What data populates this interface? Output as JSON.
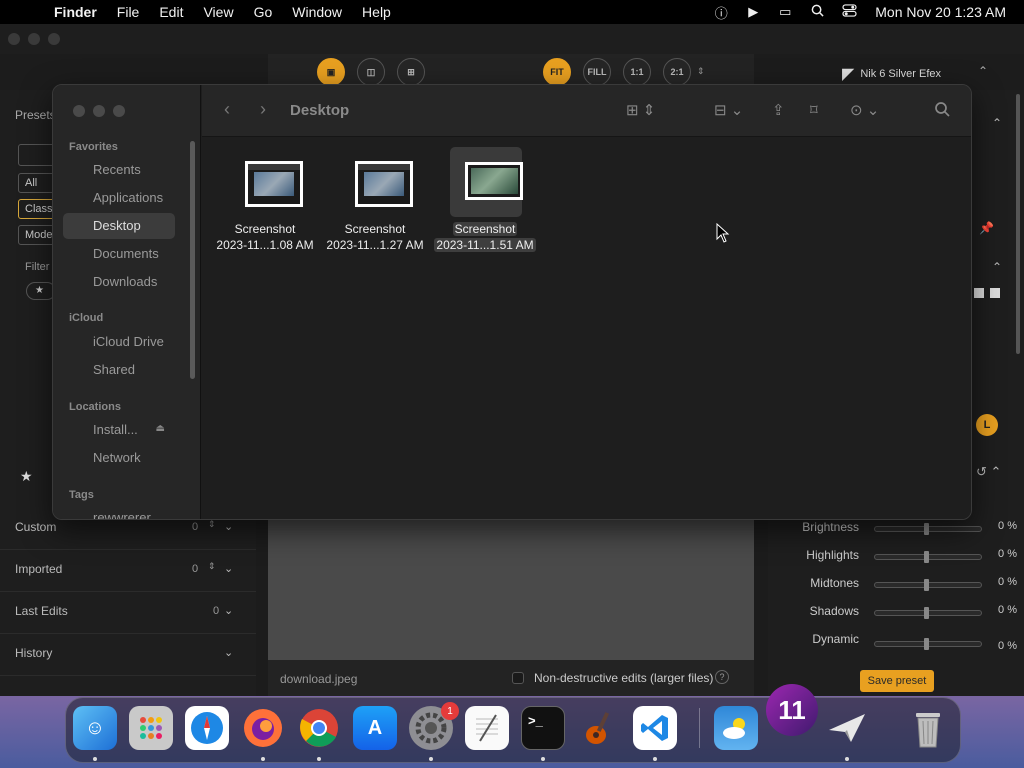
{
  "menubar": {
    "apple": "",
    "app_name": "Finder",
    "menus": [
      "File",
      "Edit",
      "View",
      "Go",
      "Window",
      "Help"
    ],
    "status_icons": [
      "accessibility-icon",
      "play-icon",
      "screen-mirror-icon",
      "search-icon",
      "control-center-icon"
    ],
    "clock": "Mon Nov 20  1:23 AM"
  },
  "nik": {
    "title": "Nik 6 Silver Efex",
    "toolbar": {
      "fit": "FIT",
      "fill": "FILL",
      "one_to_one": "1:1",
      "two_to_one": "2:1"
    },
    "left": {
      "presets_label": "Presets",
      "filter_all": "All",
      "filter_classic": "Class",
      "filter_modern": "Mode",
      "filter_label": "Filter",
      "star": "★",
      "rows": [
        {
          "label": "Custom",
          "count": "0"
        },
        {
          "label": "Imported",
          "count": "0"
        },
        {
          "label": "Last Edits",
          "count": "0"
        },
        {
          "label": "History",
          "count": ""
        }
      ]
    },
    "bottom": {
      "filename": "download.jpeg",
      "non_destructive": "Non-destructive edits (larger files)",
      "help": "?"
    },
    "right": {
      "l_badge": "L",
      "sliders": [
        {
          "label": "Brightness",
          "value": "0 %"
        },
        {
          "label": "Highlights",
          "value": "0 %"
        },
        {
          "label": "Midtones",
          "value": "0 %"
        },
        {
          "label": "Shadows",
          "value": "0 %"
        },
        {
          "label": "Dynamic",
          "value": "0 %"
        }
      ],
      "save_preset": "Save preset"
    }
  },
  "finder": {
    "title": "Desktop",
    "sidebar": {
      "favorites_label": "Favorites",
      "favorites": [
        "Recents",
        "Applications",
        "Desktop",
        "Documents",
        "Downloads"
      ],
      "icloud_label": "iCloud",
      "icloud": [
        "iCloud Drive",
        "Shared"
      ],
      "locations_label": "Locations",
      "locations": [
        "Install...",
        "Network"
      ],
      "tags_label": "Tags",
      "tags": [
        "rewwrerer"
      ]
    },
    "files": [
      {
        "line1": "Screenshot",
        "line2": "2023-11...1.08 AM"
      },
      {
        "line1": "Screenshot",
        "line2": "2023-11...1.27 AM"
      },
      {
        "line1": "Screenshot",
        "line2": "2023-11...1.51 AM"
      }
    ]
  },
  "dock": {
    "apps": [
      "Finder",
      "Launchpad",
      "Safari",
      "Firefox",
      "Chrome",
      "App Store",
      "System Settings",
      "TextEdit",
      "Terminal",
      "GarageBand",
      "VS Code",
      "Weather",
      "11",
      "Nik Silver Efex",
      "Trash"
    ],
    "settings_badge": "1",
    "eleven_label": "11"
  }
}
